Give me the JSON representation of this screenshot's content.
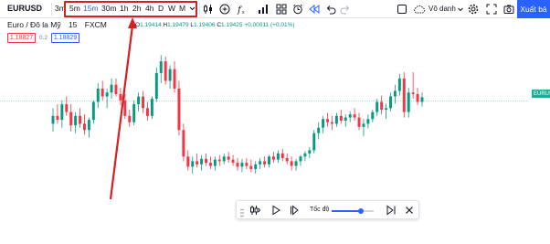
{
  "toolbar": {
    "symbol": "EURUSD",
    "timeframes": [
      {
        "label": "3m",
        "active": false
      },
      {
        "label": "5m",
        "active": false
      },
      {
        "label": "15m",
        "active": true
      },
      {
        "label": "30m",
        "active": false
      },
      {
        "label": "1h",
        "active": false
      },
      {
        "label": "2h",
        "active": false
      },
      {
        "label": "4h",
        "active": false
      },
      {
        "label": "D",
        "active": false
      },
      {
        "label": "W",
        "active": false
      },
      {
        "label": "M",
        "active": false
      }
    ],
    "timeframe_more_icon": "chevron-down-icon",
    "icons": [
      "candles-icon",
      "add-compare-icon",
      "indicators-icon",
      "chart-templates-icon",
      "alert-icon",
      "replay-icon",
      "undo-icon",
      "redo-icon",
      "layout-icon"
    ],
    "cloud_label": "Vô danh",
    "settings_icon": "gear-icon",
    "fullscreen_icon": "fullscreen-icon",
    "snapshot_icon": "camera-icon",
    "publish_label": "Xuất bả"
  },
  "legend": {
    "title": "Euro / Đô la Mỹ",
    "interval": "15",
    "exchange": "FXCM",
    "ohlc": {
      "o_label": "O",
      "o": "1.19414",
      "h_label": "H",
      "h": "1.19479",
      "l_label": "L",
      "l": "1.19406",
      "c_label": "C",
      "c": "1.19425",
      "change": "+0.00011 (+0.01%)"
    },
    "sell_price": "1.18827",
    "spread": "0.2",
    "buy_price": "1.18829"
  },
  "price_scale": {
    "current_tag": "EURUSD"
  },
  "replay_bar": {
    "speed_label": "Tốc độ",
    "speed_level": 0.7,
    "icons": [
      "drag-handle-icon",
      "select-bar-icon",
      "play-icon",
      "step-forward-icon",
      "jump-to-realtime-icon",
      "close-icon"
    ]
  },
  "colors": {
    "up": "#089981",
    "down": "#f23645",
    "accent": "#2962ff",
    "annotation": "#d62020",
    "price_line": "#22ab94"
  },
  "chart_data": {
    "type": "candlestick",
    "symbol": "EURUSD",
    "interval": "15",
    "candles": [
      [
        1.186,
        1.188,
        1.185,
        1.187
      ],
      [
        1.187,
        1.1885,
        1.186,
        1.1865
      ],
      [
        1.1865,
        1.189,
        1.1855,
        1.1885
      ],
      [
        1.1885,
        1.1895,
        1.187,
        1.1875
      ],
      [
        1.1875,
        1.1885,
        1.185,
        1.1858
      ],
      [
        1.1858,
        1.1875,
        1.1848,
        1.187
      ],
      [
        1.187,
        1.188,
        1.1855,
        1.186
      ],
      [
        1.186,
        1.1872,
        1.1846,
        1.1852
      ],
      [
        1.1852,
        1.1868,
        1.1842,
        1.1865
      ],
      [
        1.1865,
        1.189,
        1.186,
        1.1888
      ],
      [
        1.1888,
        1.1912,
        1.188,
        1.1905
      ],
      [
        1.1905,
        1.1915,
        1.189,
        1.1895
      ],
      [
        1.1895,
        1.1905,
        1.188,
        1.19
      ],
      [
        1.19,
        1.1918,
        1.1892,
        1.191
      ],
      [
        1.191,
        1.1918,
        1.1895,
        1.1898
      ],
      [
        1.1898,
        1.1906,
        1.1884,
        1.189
      ],
      [
        1.189,
        1.1898,
        1.1866,
        1.187
      ],
      [
        1.187,
        1.1878,
        1.1856,
        1.1862
      ],
      [
        1.1862,
        1.189,
        1.1858,
        1.1885
      ],
      [
        1.1885,
        1.19,
        1.1876,
        1.1895
      ],
      [
        1.1895,
        1.1902,
        1.1874,
        1.188
      ],
      [
        1.188,
        1.1888,
        1.1864,
        1.187
      ],
      [
        1.187,
        1.1895,
        1.1866,
        1.1892
      ],
      [
        1.1892,
        1.1932,
        1.1888,
        1.1925
      ],
      [
        1.1925,
        1.1948,
        1.1912,
        1.194
      ],
      [
        1.194,
        1.1946,
        1.191,
        1.1915
      ],
      [
        1.1915,
        1.1935,
        1.1905,
        1.193
      ],
      [
        1.193,
        1.194,
        1.19,
        1.1905
      ],
      [
        1.1905,
        1.1915,
        1.1845,
        1.1852
      ],
      [
        1.1852,
        1.186,
        1.1812,
        1.1818
      ],
      [
        1.1818,
        1.1826,
        1.18,
        1.1805
      ],
      [
        1.1805,
        1.1818,
        1.1796,
        1.1812
      ],
      [
        1.1812,
        1.1822,
        1.1804,
        1.1808
      ],
      [
        1.1808,
        1.182,
        1.18,
        1.1815
      ],
      [
        1.1815,
        1.1822,
        1.1806,
        1.181
      ],
      [
        1.181,
        1.1818,
        1.1802,
        1.1806
      ],
      [
        1.1806,
        1.1818,
        1.18,
        1.1814
      ],
      [
        1.1814,
        1.182,
        1.1806,
        1.1812
      ],
      [
        1.1812,
        1.1822,
        1.1808,
        1.1818
      ],
      [
        1.1818,
        1.1824,
        1.181,
        1.1814
      ],
      [
        1.1814,
        1.182,
        1.1806,
        1.181
      ],
      [
        1.181,
        1.1816,
        1.18,
        1.1805
      ],
      [
        1.1805,
        1.1815,
        1.1798,
        1.181
      ],
      [
        1.181,
        1.1816,
        1.1802,
        1.1806
      ],
      [
        1.1806,
        1.1814,
        1.1798,
        1.1802
      ],
      [
        1.1802,
        1.1812,
        1.1796,
        1.1808
      ],
      [
        1.1808,
        1.1816,
        1.1802,
        1.1812
      ],
      [
        1.1812,
        1.1818,
        1.1804,
        1.1808
      ],
      [
        1.1808,
        1.182,
        1.1804,
        1.1818
      ],
      [
        1.1818,
        1.1824,
        1.181,
        1.1814
      ],
      [
        1.1814,
        1.1826,
        1.181,
        1.1822
      ],
      [
        1.1822,
        1.1828,
        1.1812,
        1.1816
      ],
      [
        1.1816,
        1.1822,
        1.1808,
        1.1812
      ],
      [
        1.1812,
        1.1818,
        1.18,
        1.1806
      ],
      [
        1.1806,
        1.1815,
        1.18,
        1.1812
      ],
      [
        1.1812,
        1.182,
        1.1806,
        1.1818
      ],
      [
        1.1818,
        1.1825,
        1.1812,
        1.1822
      ],
      [
        1.1822,
        1.183,
        1.1816,
        1.1826
      ],
      [
        1.1826,
        1.1852,
        1.1822,
        1.1848
      ],
      [
        1.1848,
        1.1862,
        1.184,
        1.1855
      ],
      [
        1.1855,
        1.187,
        1.1848,
        1.1866
      ],
      [
        1.1866,
        1.1874,
        1.1856,
        1.1862
      ],
      [
        1.1862,
        1.187,
        1.1852,
        1.186
      ],
      [
        1.186,
        1.1874,
        1.1856,
        1.187
      ],
      [
        1.187,
        1.1878,
        1.186,
        1.1864
      ],
      [
        1.1864,
        1.1872,
        1.1856,
        1.1868
      ],
      [
        1.1868,
        1.1876,
        1.1862,
        1.1872
      ],
      [
        1.1872,
        1.188,
        1.1864,
        1.1868
      ],
      [
        1.1868,
        1.1874,
        1.1852,
        1.1856
      ],
      [
        1.1856,
        1.1866,
        1.1844,
        1.186
      ],
      [
        1.186,
        1.1872,
        1.1854,
        1.1866
      ],
      [
        1.1866,
        1.1878,
        1.1862,
        1.1875
      ],
      [
        1.1875,
        1.1892,
        1.187,
        1.1888
      ],
      [
        1.1888,
        1.1896,
        1.1872,
        1.1878
      ],
      [
        1.1878,
        1.1886,
        1.1866,
        1.188
      ],
      [
        1.188,
        1.19,
        1.1876,
        1.1895
      ],
      [
        1.1895,
        1.191,
        1.1886,
        1.1902
      ],
      [
        1.1902,
        1.1924,
        1.1896,
        1.1918
      ],
      [
        1.1918,
        1.1926,
        1.1868,
        1.1875
      ],
      [
        1.1875,
        1.1906,
        1.1868,
        1.19
      ],
      [
        1.19,
        1.1926,
        1.1892,
        1.1898
      ],
      [
        1.1898,
        1.1906,
        1.1884,
        1.1888
      ],
      [
        1.1888,
        1.19,
        1.1882,
        1.1894
      ]
    ],
    "last_price_line": 1.1889,
    "ylim": [
      1.172,
      1.196
    ]
  }
}
